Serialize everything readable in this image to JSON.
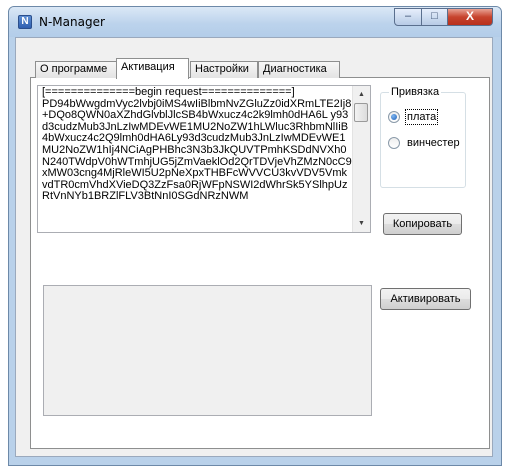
{
  "window": {
    "title": "N-Manager",
    "app_icon_letter": "N",
    "controls": {
      "minimize": "–",
      "maximize": "□",
      "close": "X"
    }
  },
  "tabs": [
    {
      "label": "О программе",
      "active": false
    },
    {
      "label": "Активация",
      "active": true
    },
    {
      "label": "Настройки",
      "active": false
    },
    {
      "label": "Диагностика",
      "active": false
    }
  ],
  "request": {
    "text": "[==============begin request==============]\nPD94bWwgdmVyc2lvbj0iMS4wIiBlbmNvZGluZz0idXRmLTE2Ij8\n+DQo8QWN0aXZhdGlvblJlcSB4bWxucz4c2k9lmh0dHA6L y93d3cudzMub3JnLzIwMDEvWE1MU2NoZW1hLWluc3RhbmNlIiB4bWxucz4c2Q9lmh0dHA6Ly93d3cudzMub3JnLzIwMDEvWE1MU2NoZW1hIj4NCiAgPHBhc3N3b3JkQUVTPmhKSDdNVXh0N240TWdpV0hWTmhjUG5jZmVaeklOd2QrTDVjeVhZMzN0cC9xMW03cng4MjRleWI5U2pNeXpxTHBFcWVVCU3kvVDV5VmkvdTR0cmVhdXVieDQ3ZzFsa0RjWFpNSWI2dWhrSk5YSlhpUzRtVnNYb1BRZlFLV3BtNnI0SGdNRzNWM",
    "scroll": {
      "up": "▲",
      "down": "▼"
    }
  },
  "binding": {
    "group_label": "Привязка",
    "options": [
      {
        "label": "плата",
        "checked": true
      },
      {
        "label": "винчестер",
        "checked": false
      }
    ]
  },
  "buttons": {
    "copy": "Копировать",
    "activate": "Активировать"
  },
  "activation": {
    "value": ""
  }
}
